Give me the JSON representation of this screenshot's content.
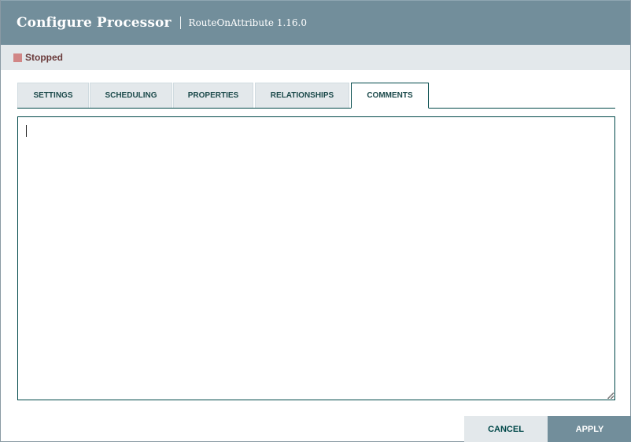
{
  "dialog": {
    "title": "Configure Processor",
    "subtitle": "RouteOnAttribute 1.16.0"
  },
  "status": {
    "icon": "stopped-square-icon",
    "label": "Stopped",
    "color": "#d18686"
  },
  "tabs": [
    {
      "label": "SETTINGS",
      "active": false
    },
    {
      "label": "SCHEDULING",
      "active": false
    },
    {
      "label": "PROPERTIES",
      "active": false
    },
    {
      "label": "RELATIONSHIPS",
      "active": false
    },
    {
      "label": "COMMENTS",
      "active": true
    }
  ],
  "comments": {
    "value": "",
    "placeholder": ""
  },
  "footer": {
    "cancel_label": "CANCEL",
    "apply_label": "APPLY"
  },
  "colors": {
    "header": "#728e9b",
    "accent": "#004849",
    "status_bar": "#e3e8eb"
  }
}
